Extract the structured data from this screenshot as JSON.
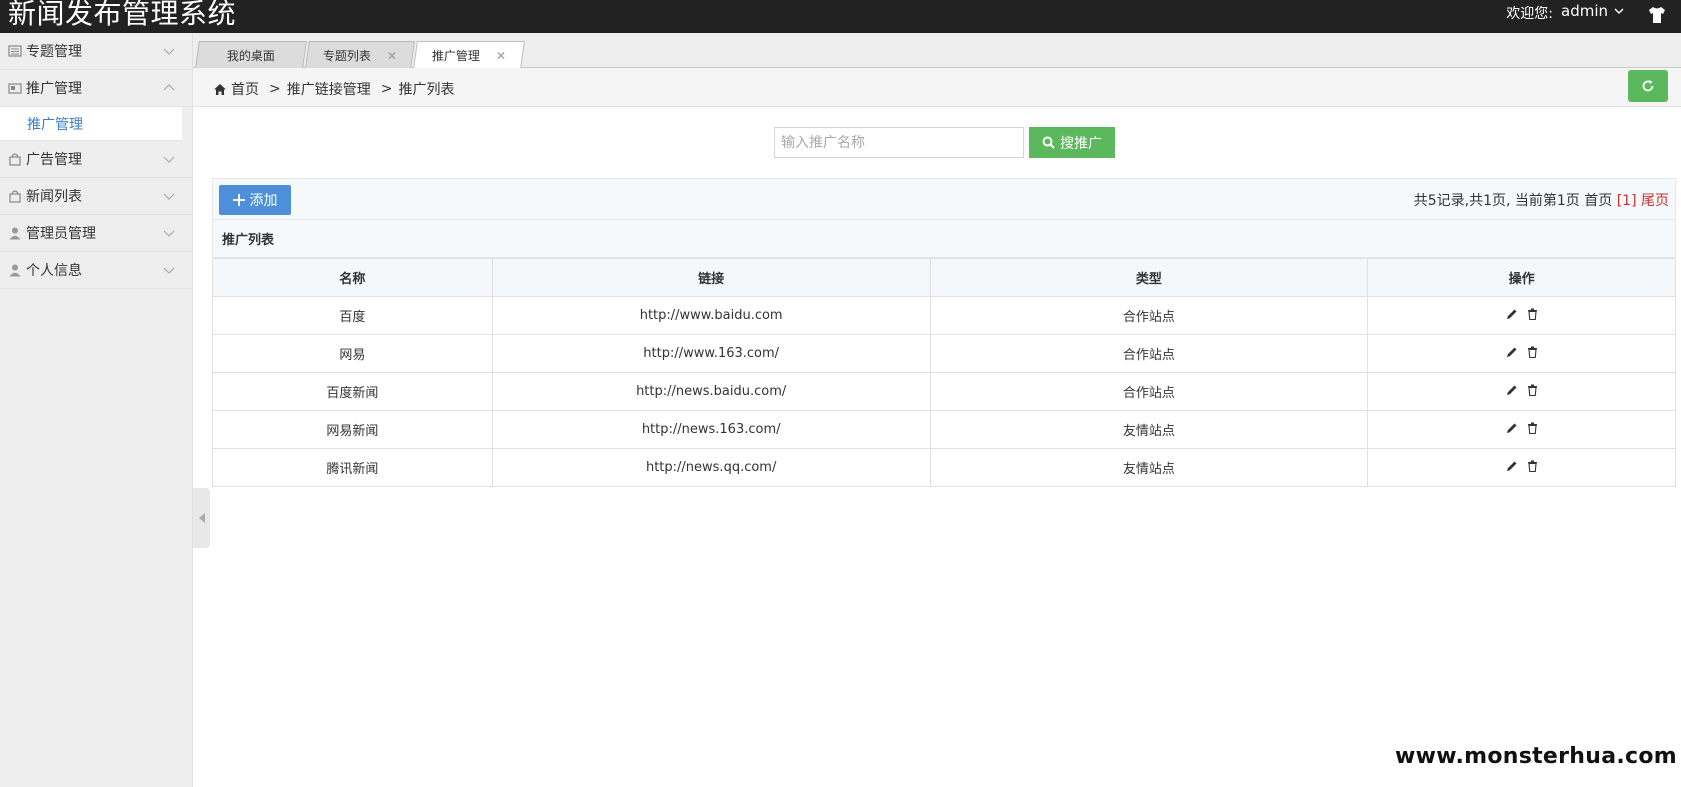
{
  "header": {
    "title": "新闻发布管理系统",
    "welcome": "欢迎您:",
    "user": "admin"
  },
  "sidebar": {
    "items": [
      {
        "label": "专题管理",
        "icon": "newspaper-icon",
        "expanded": false
      },
      {
        "label": "推广管理",
        "icon": "card-icon",
        "expanded": true,
        "children": [
          {
            "label": "推广管理",
            "active": true
          }
        ]
      },
      {
        "label": "广告管理",
        "icon": "bag-icon",
        "expanded": false
      },
      {
        "label": "新闻列表",
        "icon": "bag-icon",
        "expanded": false
      },
      {
        "label": "管理员管理",
        "icon": "person-icon",
        "expanded": false
      },
      {
        "label": "个人信息",
        "icon": "person-icon",
        "expanded": false
      }
    ]
  },
  "tabs": [
    {
      "label": "我的桌面",
      "closable": false
    },
    {
      "label": "专题列表",
      "closable": true
    },
    {
      "label": "推广管理",
      "closable": true,
      "active": true
    }
  ],
  "breadcrumb": {
    "home": "首页",
    "items": [
      "推广链接管理",
      "推广列表"
    ],
    "separator": ">"
  },
  "search": {
    "placeholder": "输入推广名称",
    "button": "搜推广"
  },
  "toolbar": {
    "add_label": "添加",
    "pager_text": "共5记录,共1页, 当前第1页 首页",
    "pager_current": "[1]",
    "pager_last": "尾页"
  },
  "table": {
    "title": "推广列表",
    "columns": [
      "名称",
      "链接",
      "类型",
      "操作"
    ],
    "rows": [
      {
        "name": "百度",
        "link": "http://www.baidu.com",
        "type": "合作站点"
      },
      {
        "name": "网易",
        "link": "http://www.163.com/",
        "type": "合作站点"
      },
      {
        "name": "百度新闻",
        "link": "http://news.baidu.com/",
        "type": "合作站点"
      },
      {
        "name": "网易新闻",
        "link": "http://news.163.com/",
        "type": "友情站点"
      },
      {
        "name": "腾讯新闻",
        "link": "http://news.qq.com/",
        "type": "友情站点"
      }
    ]
  },
  "watermark": "www.monsterhua.com",
  "colors": {
    "header_bg": "#222222",
    "success": "#5cb85c",
    "primary": "#4d8fd8",
    "link_active": "#3a7fc3",
    "danger": "#c9302c"
  }
}
